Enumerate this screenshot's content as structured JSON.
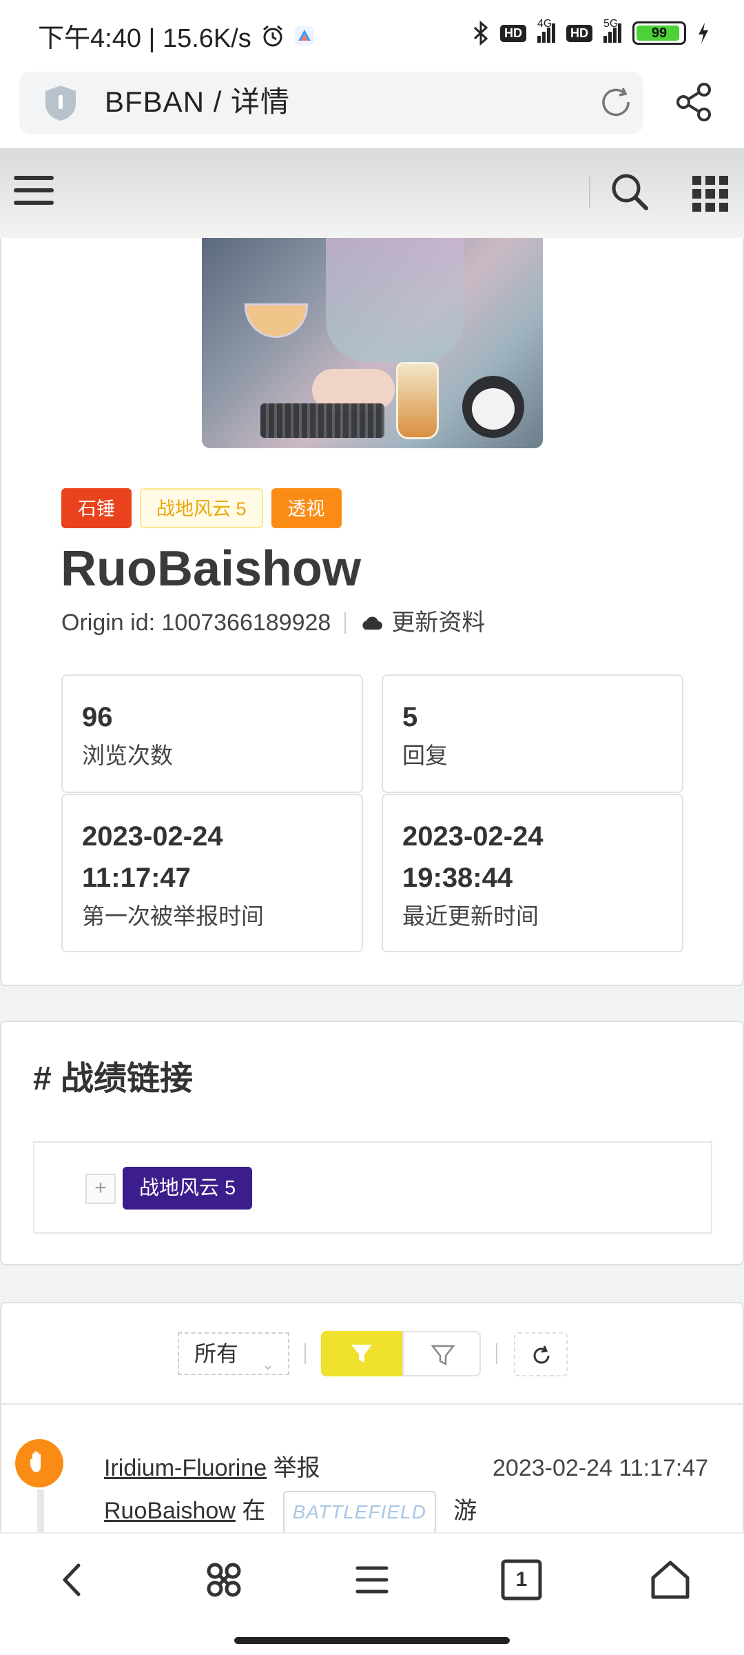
{
  "status_bar": {
    "time_speed": "下午4:40 | 15.6K/s",
    "hd1": "HD",
    "net1": "4G",
    "hd2": "HD",
    "net2": "5G",
    "battery": "99"
  },
  "browser": {
    "url_title": "BFBAN / 详情"
  },
  "profile": {
    "tags": [
      "石锤",
      "战地风云 5",
      "透视"
    ],
    "username": "RuoBaishow",
    "origin_id": "Origin id: 1007366189928",
    "update_label": "更新资料",
    "stats": [
      {
        "value": "96",
        "label": "浏览次数"
      },
      {
        "value": "5",
        "label": "回复"
      },
      {
        "value": "2023-02-24",
        "value2": "11:17:47",
        "label": "第一次被举报时间"
      },
      {
        "value": "2023-02-24",
        "value2": "19:38:44",
        "label": "最近更新时间"
      }
    ]
  },
  "links_section": {
    "title": "# 战绩链接",
    "plus": "+",
    "game_button": "战地风云 5"
  },
  "timeline": {
    "filter_select": "所有",
    "entry": {
      "reporter": "Iridium-Fluorine",
      "action": "举报",
      "target": "RuoBaishow",
      "preposition": "在",
      "game_badge": "BATTLEFIELD V",
      "suffix": "游",
      "time": "2023-02-24 11:17:47"
    }
  },
  "colors": {
    "tag_red": "#e8431c",
    "tag_gold_text": "#e8a60a",
    "tag_orange": "#fa8c16",
    "game_button": "#3c1d8c",
    "filter_active": "#f0e12c",
    "timeline_dot": "#fa8c16"
  },
  "icons": {
    "status": [
      "alarm-icon",
      "app-icon",
      "bluetooth-icon",
      "signal-icon",
      "battery-icon",
      "charging-icon"
    ],
    "browser": [
      "shield-icon",
      "reload-icon",
      "share-icon"
    ],
    "header": [
      "hamburger-icon",
      "search-icon",
      "apps-grid-icon"
    ],
    "bottom_nav": [
      "back-icon",
      "command-icon",
      "menu-icon",
      "tabs-icon",
      "home-icon"
    ],
    "timeline": [
      "hand-stop-icon",
      "filter-icon",
      "filter-outline-icon",
      "refresh-icon",
      "chevron-down-icon",
      "cloud-icon"
    ]
  },
  "bottom_nav": {
    "tabs_count": "1"
  }
}
